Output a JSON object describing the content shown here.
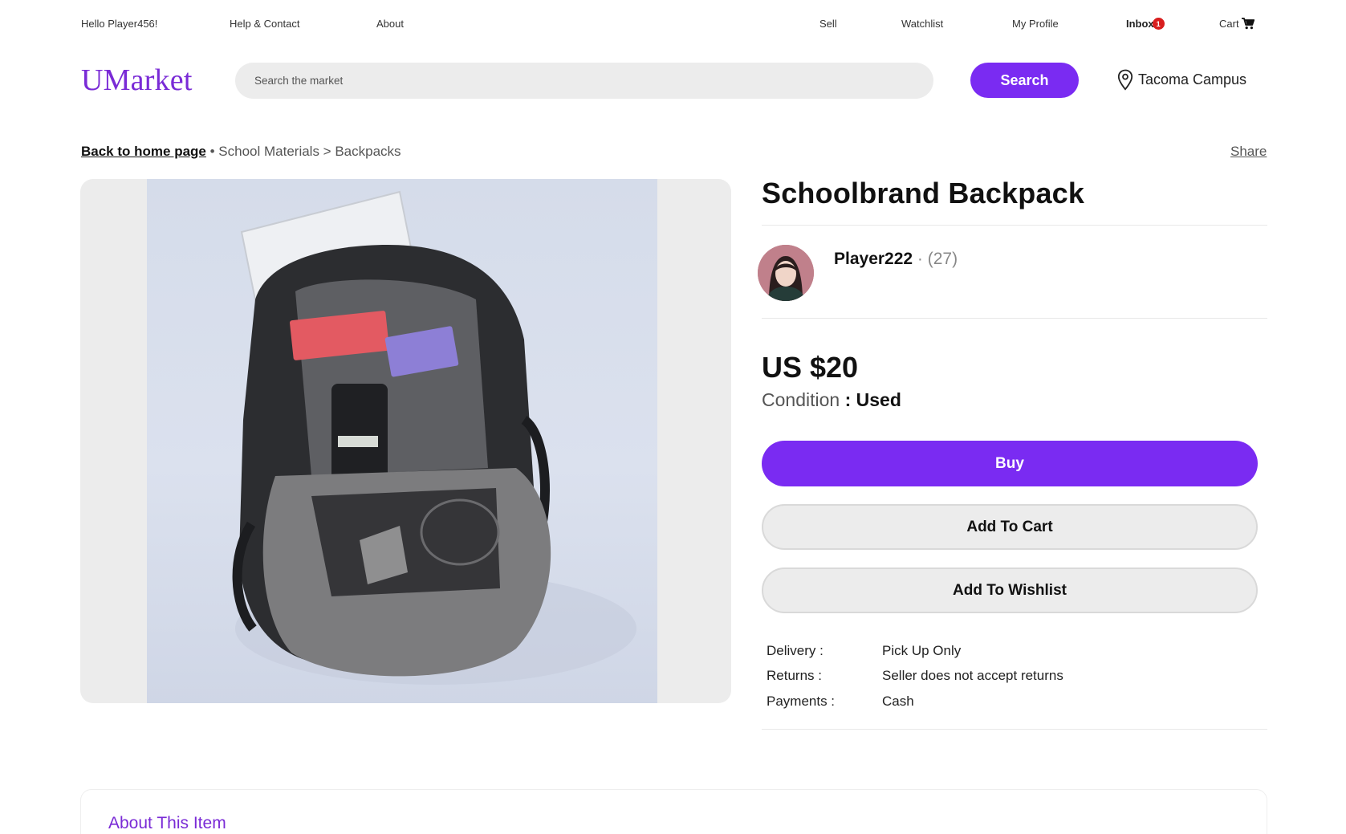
{
  "topnav": {
    "greeting": "Hello Player456!",
    "help": "Help & Contact",
    "about": "About",
    "sell": "Sell",
    "watchlist": "Watchlist",
    "profile": "My Profile",
    "inbox": "Inbox",
    "inbox_badge": "1",
    "cart": "Cart"
  },
  "header": {
    "logo": "UMarket",
    "search_placeholder": "Search the market",
    "search_button": "Search",
    "location": "Tacoma Campus"
  },
  "breadcrumb": {
    "back": "Back to home page",
    "separator": " • ",
    "path": "School Materials > Backpacks"
  },
  "share": "Share",
  "product": {
    "title": "Schoolbrand Backpack",
    "seller_name": "Player222",
    "seller_count": " · (27)",
    "price": "US $20",
    "condition_label": "Condition",
    "condition_value": ": Used",
    "buy": "Buy",
    "add_to_cart": "Add To Cart",
    "add_to_wishlist": "Add To Wishlist",
    "details": [
      {
        "label": "Delivery :",
        "value": "Pick Up Only"
      },
      {
        "label": "Returns :",
        "value": "Seller does not accept returns"
      },
      {
        "label": "Payments :",
        "value": "Cash"
      }
    ]
  },
  "about": {
    "title": "About This Item"
  },
  "colors": {
    "brand": "#7a2bf2",
    "badge": "#d81e1e"
  }
}
